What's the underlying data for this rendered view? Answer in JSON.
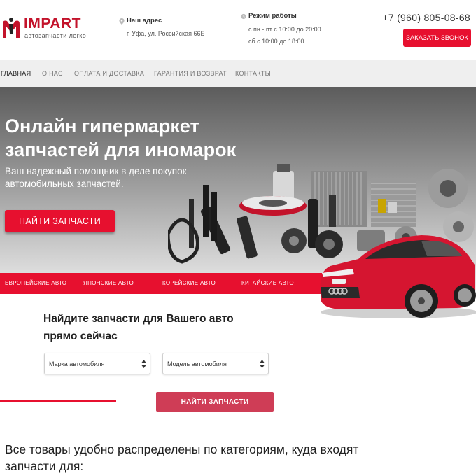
{
  "header": {
    "logo_title": "IMPART",
    "logo_subtitle": "автозапчасти легко",
    "address_title": "Наш адрес",
    "address_text": "г. Уфа, ул. Российская 66Б",
    "hours_title": "Режим работы",
    "hours_line1": "с пн - пт с 10:00 до 20:00",
    "hours_line2": "сб с 10:00 до 18:00",
    "phone": "+7 (960) 805-08-68",
    "callback_label": "ЗАКАЗАТЬ ЗВОНОК"
  },
  "nav": {
    "items": [
      "ГЛАВНАЯ",
      "О НАС",
      "ОПЛАТА И ДОСТАВКА",
      "ГАРАНТИЯ И ВОЗВРАТ",
      "КОНТАКТЫ"
    ]
  },
  "hero": {
    "title": "Онлайн гипермаркет запчастей для иномарок",
    "subtitle": "Ваш надежный помощник в деле покупок автомобильных запчастей.",
    "button_label": "НАЙТИ ЗАПЧАСТИ",
    "categories": [
      "ЕВРОПЕЙСКИЕ АВТО",
      "ЯПОНСКИЕ АВТО",
      "КОРЕЙСКИЕ АВТО",
      "КИТАЙСКИЕ АВТО"
    ]
  },
  "search": {
    "title": "Найдите запчасти для Вашего авто прямо сейчас",
    "brand_select": "Марка автомобиля",
    "model_select": "Модель автомобиля",
    "button_label": "НАЙТИ ЗАПЧАСТИ"
  },
  "categories_section": {
    "text": "Все товары удобно распределены по категориям, куда входят запчасти для:"
  },
  "colors": {
    "accent": "#e7102f",
    "nav_bg": "#efefef",
    "search_button": "#cf3d56"
  },
  "icons": [
    "logo-mark-icon",
    "map-pin-icon",
    "clock-icon",
    "select-arrow-icon"
  ]
}
